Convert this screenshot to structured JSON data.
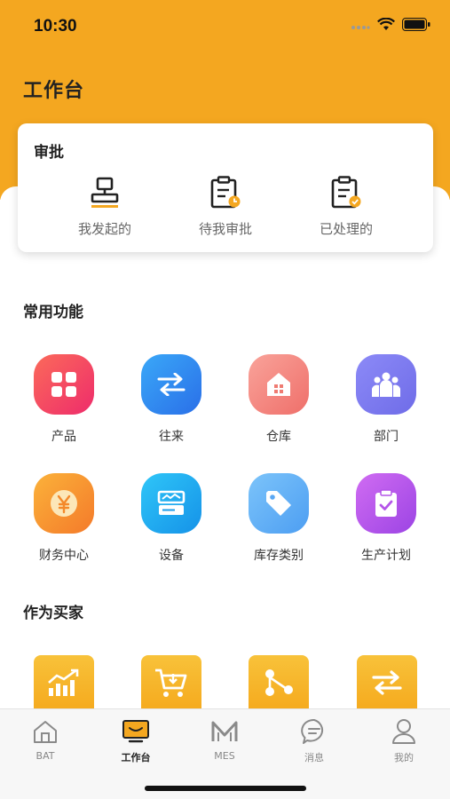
{
  "status_bar": {
    "time": "10:30"
  },
  "page_title": "工作台",
  "approval": {
    "title": "审批",
    "items": [
      {
        "label": "我发起的",
        "icon": "stamp-icon"
      },
      {
        "label": "待我审批",
        "icon": "clipboard-pending-icon"
      },
      {
        "label": "已处理的",
        "icon": "clipboard-done-icon"
      }
    ]
  },
  "common_functions": {
    "title": "常用功能",
    "items": [
      {
        "label": "产品",
        "icon": "grid-icon",
        "color": "#F0405E"
      },
      {
        "label": "往来",
        "icon": "exchange-icon",
        "color": "#2F8BF0"
      },
      {
        "label": "仓库",
        "icon": "warehouse-icon",
        "color": "#F07F78"
      },
      {
        "label": "部门",
        "icon": "team-icon",
        "color": "#7A78F0"
      },
      {
        "label": "财务中心",
        "icon": "yen-coin-icon",
        "color": "#F58A2E"
      },
      {
        "label": "设备",
        "icon": "device-icon",
        "color": "#1FA8F2"
      },
      {
        "label": "库存类别",
        "icon": "tag-icon",
        "color": "#5AB0F5"
      },
      {
        "label": "生产计划",
        "icon": "clipboard-check-icon",
        "color": "#B455E8"
      }
    ]
  },
  "buyer": {
    "title": "作为买家",
    "items": [
      {
        "icon": "growth-chart-icon"
      },
      {
        "icon": "cart-icon"
      },
      {
        "icon": "share-nodes-icon"
      },
      {
        "icon": "swap-icon"
      }
    ]
  },
  "tab_bar": {
    "items": [
      {
        "label": "BAT",
        "icon": "home-icon",
        "active": false
      },
      {
        "label": "工作台",
        "icon": "monitor-icon",
        "active": true
      },
      {
        "label": "MES",
        "icon": "m-logo-icon",
        "active": false
      },
      {
        "label": "消息",
        "icon": "chat-icon",
        "active": false
      },
      {
        "label": "我的",
        "icon": "user-icon",
        "active": false
      }
    ]
  },
  "colors": {
    "accent": "#F4A720",
    "active_tab": "#222222"
  }
}
